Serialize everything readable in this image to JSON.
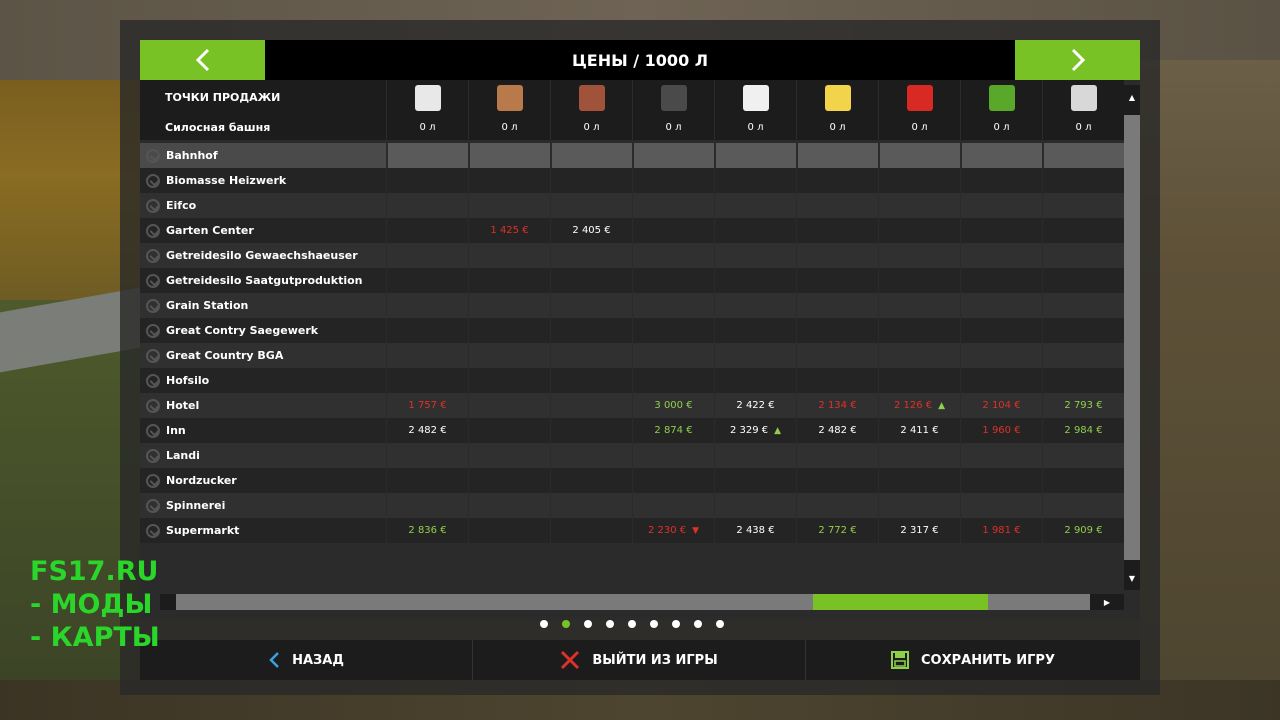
{
  "header": {
    "title": "ЦЕНЫ / 1000 Л"
  },
  "table": {
    "selling_points_label": "ТОЧКИ ПРОДАЖИ",
    "silo_label": "Силосная башня",
    "products": [
      {
        "icon": "fertilizer-bag-icon",
        "color": "#e8e8e8",
        "silo": "0 л"
      },
      {
        "icon": "wood-chips-icon",
        "color": "#b87a4a",
        "silo": "0 л"
      },
      {
        "icon": "boards-icon",
        "color": "#a0523a",
        "silo": "0 л"
      },
      {
        "icon": "coal-icon",
        "color": "#4a4a4a",
        "silo": "0 л"
      },
      {
        "icon": "milk-bottle-icon",
        "color": "#f0f0f0",
        "silo": "0 л"
      },
      {
        "icon": "cheese-icon",
        "color": "#f2d44a",
        "silo": "0 л"
      },
      {
        "icon": "tomato-icon",
        "color": "#d82a22",
        "silo": "0 л"
      },
      {
        "icon": "lettuce-icon",
        "color": "#5aa82a",
        "silo": "0 л"
      },
      {
        "icon": "wool-icon",
        "color": "#d8d8d8",
        "silo": "0 л"
      }
    ],
    "rows": [
      {
        "name": "Bahnhof",
        "cells": [
          "",
          "",
          "",
          "",
          "",
          "",
          "",
          "",
          ""
        ]
      },
      {
        "name": "Biomasse Heizwerk",
        "cells": [
          "",
          "",
          "",
          "",
          "",
          "",
          "",
          "",
          ""
        ]
      },
      {
        "name": "Eifco",
        "cells": [
          "",
          "",
          "",
          "",
          "",
          "",
          "",
          "",
          ""
        ]
      },
      {
        "name": "Garten Center",
        "cells": [
          "",
          "1 425 €",
          "2 405 €",
          "",
          "",
          "",
          "",
          "",
          ""
        ],
        "colors": [
          "",
          "red",
          "white",
          "",
          "",
          "",
          "",
          "",
          ""
        ]
      },
      {
        "name": "Getreidesilo Gewaechshaeuser",
        "cells": [
          "",
          "",
          "",
          "",
          "",
          "",
          "",
          "",
          ""
        ]
      },
      {
        "name": "Getreidesilo Saatgutproduktion",
        "cells": [
          "",
          "",
          "",
          "",
          "",
          "",
          "",
          "",
          ""
        ]
      },
      {
        "name": "Grain Station",
        "cells": [
          "",
          "",
          "",
          "",
          "",
          "",
          "",
          "",
          ""
        ]
      },
      {
        "name": "Great Contry Saegewerk",
        "cells": [
          "",
          "",
          "",
          "",
          "",
          "",
          "",
          "",
          ""
        ]
      },
      {
        "name": "Great Country BGA",
        "cells": [
          "",
          "",
          "",
          "",
          "",
          "",
          "",
          "",
          ""
        ]
      },
      {
        "name": "Hofsilo",
        "cells": [
          "",
          "",
          "",
          "",
          "",
          "",
          "",
          "",
          ""
        ]
      },
      {
        "name": "Hotel",
        "cells": [
          "1 757 €",
          "",
          "",
          "3 000 €",
          "2 422 €",
          "2 134 €",
          "2 126 €",
          "2 104 €",
          "2 793 €"
        ],
        "colors": [
          "red",
          "",
          "",
          "green",
          "white",
          "red",
          "red",
          "red",
          "green"
        ],
        "arrows": [
          "",
          "",
          "",
          "",
          "",
          "",
          "up",
          "",
          ""
        ]
      },
      {
        "name": "Inn",
        "cells": [
          "2 482 €",
          "",
          "",
          "2 874 €",
          "2 329 €",
          "2 482 €",
          "2 411 €",
          "1 960 €",
          "2 984 €"
        ],
        "colors": [
          "white",
          "",
          "",
          "green",
          "white",
          "white",
          "white",
          "red",
          "green"
        ],
        "arrows": [
          "",
          "",
          "",
          "",
          "up",
          "",
          "",
          "",
          ""
        ]
      },
      {
        "name": "Landi",
        "cells": [
          "",
          "",
          "",
          "",
          "",
          "",
          "",
          "",
          ""
        ]
      },
      {
        "name": "Nordzucker",
        "cells": [
          "",
          "",
          "",
          "",
          "",
          "",
          "",
          "",
          ""
        ]
      },
      {
        "name": "Spinnerei",
        "cells": [
          "",
          "",
          "",
          "",
          "",
          "",
          "",
          "",
          ""
        ]
      },
      {
        "name": "Supermarkt",
        "cells": [
          "2 836 €",
          "",
          "",
          "2 230 €",
          "2 438 €",
          "2 772 €",
          "2 317 €",
          "1 981 €",
          "2 909 €"
        ],
        "colors": [
          "green",
          "",
          "",
          "red",
          "white",
          "green",
          "white",
          "red",
          "green"
        ],
        "arrows": [
          "",
          "",
          "",
          "down",
          "",
          "",
          "",
          "",
          ""
        ]
      }
    ]
  },
  "pagination": {
    "count": 9,
    "active_index": 1
  },
  "footer": {
    "back_label": "НАЗАД",
    "quit_label": "ВЫЙТИ ИЗ ИГРЫ",
    "save_label": "СОХРАНИТЬ ИГРУ"
  },
  "watermark": {
    "line1": "FS17.RU",
    "line2": "- МОДЫ",
    "line3": "- КАРТЫ"
  },
  "colors": {
    "accent": "#78c225",
    "price_up": "#8fd04a",
    "price_down": "#e0302a"
  }
}
